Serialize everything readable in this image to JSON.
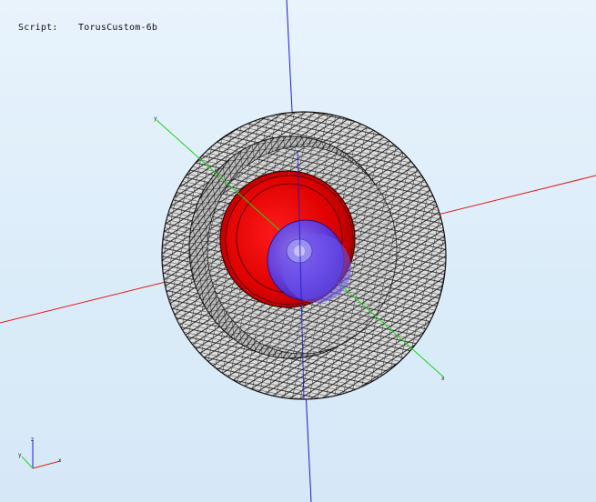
{
  "viewer": {
    "script_label": "Script:",
    "script_name": "TorusCustom-6b"
  },
  "axes": {
    "x_color": "#e21a1a",
    "y_color": "#19d619",
    "z_color": "#1a1ad6"
  },
  "model": {
    "mesh_color": "#111111",
    "shell_fill": "#d9d9d9",
    "disk_color": "#e00000",
    "sphere_color": "#6a4cf0"
  },
  "icons": {
    "orientation": "orientation-triad-icon"
  }
}
